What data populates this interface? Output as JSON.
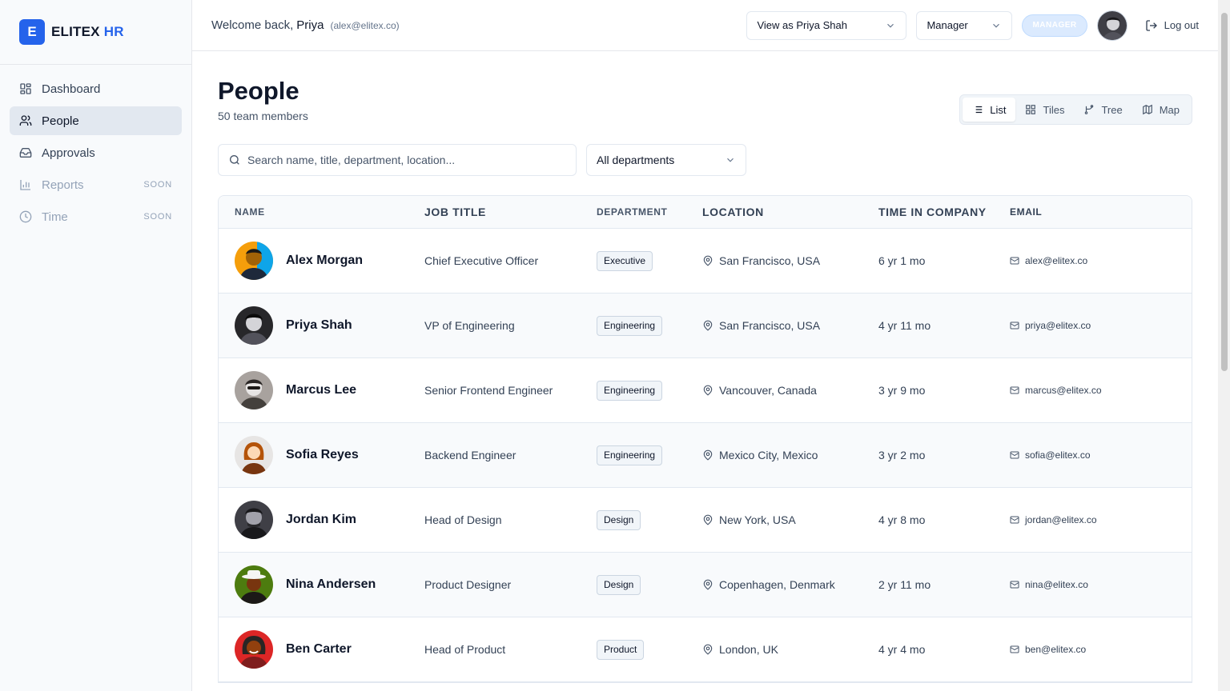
{
  "brand": {
    "logo_letter": "E",
    "name": "ELITEX",
    "suffix": "HR",
    "color": "#2563eb"
  },
  "sidebar": {
    "items": [
      {
        "label": "Dashboard",
        "icon": "dashboard-icon",
        "active": false
      },
      {
        "label": "People",
        "icon": "people-icon",
        "active": true
      },
      {
        "label": "Approvals",
        "icon": "inbox-icon",
        "active": false
      },
      {
        "label": "Reports",
        "icon": "bar-chart-icon",
        "badge": "SOON",
        "disabled": true
      },
      {
        "label": "Time",
        "icon": "clock-icon",
        "badge": "SOON",
        "disabled": true
      }
    ]
  },
  "header": {
    "welcome": "Welcome back,",
    "user_name": "Priya",
    "user_email": "(alex@elitex.co)",
    "view_as": "View as Priya Shah",
    "role": "Manager",
    "role_badge": "MANAGER",
    "logout": "Log out"
  },
  "page": {
    "title": "People",
    "subtitle": "50 team members",
    "views": [
      "List",
      "Tiles",
      "Tree",
      "Map"
    ],
    "active_view": "List",
    "search_placeholder": "Search name, title, department, location...",
    "department_filter": "All departments"
  },
  "table": {
    "columns": [
      "NAME",
      "JOB TITLE",
      "DEPARTMENT",
      "LOCATION",
      "TIME IN COMPANY",
      "EMAIL"
    ],
    "rows": [
      {
        "name": "Alex Morgan",
        "title": "Chief Executive Officer",
        "department": "Executive",
        "location": "San Francisco, USA",
        "tenure": "6 yr 1 mo",
        "email": "alex@elitex.co"
      },
      {
        "name": "Priya Shah",
        "title": "VP of Engineering",
        "department": "Engineering",
        "location": "San Francisco, USA",
        "tenure": "4 yr 11 mo",
        "email": "priya@elitex.co"
      },
      {
        "name": "Marcus Lee",
        "title": "Senior Frontend Engineer",
        "department": "Engineering",
        "location": "Vancouver, Canada",
        "tenure": "3 yr 9 mo",
        "email": "marcus@elitex.co"
      },
      {
        "name": "Sofia Reyes",
        "title": "Backend Engineer",
        "department": "Engineering",
        "location": "Mexico City, Mexico",
        "tenure": "3 yr 2 mo",
        "email": "sofia@elitex.co"
      },
      {
        "name": "Jordan Kim",
        "title": "Head of Design",
        "department": "Design",
        "location": "New York, USA",
        "tenure": "4 yr 8 mo",
        "email": "jordan@elitex.co"
      },
      {
        "name": "Nina Andersen",
        "title": "Product Designer",
        "department": "Design",
        "location": "Copenhagen, Denmark",
        "tenure": "2 yr 11 mo",
        "email": "nina@elitex.co"
      },
      {
        "name": "Ben Carter",
        "title": "Head of Product",
        "department": "Product",
        "location": "London, UK",
        "tenure": "4 yr 4 mo",
        "email": "ben@elitex.co"
      }
    ]
  }
}
